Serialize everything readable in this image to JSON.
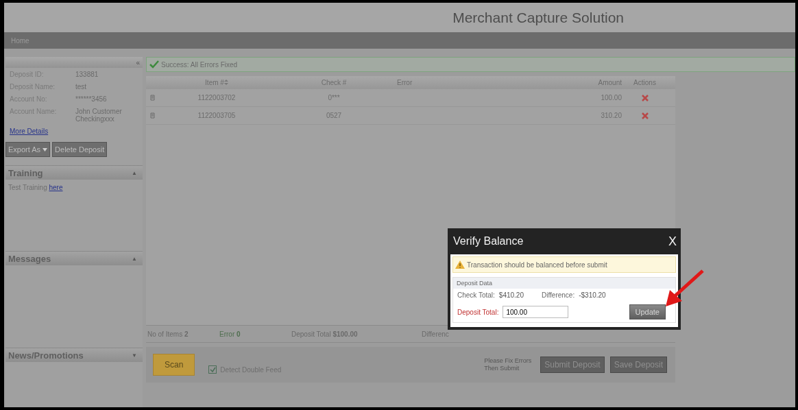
{
  "header": {
    "title": "Merchant Capture Solution"
  },
  "nav": [
    {
      "label": "Home"
    }
  ],
  "sidebar": {
    "collapse": "«",
    "details": [
      {
        "label": "Deposit ID:",
        "value": "133881"
      },
      {
        "label": "Deposit Name:",
        "value": "test"
      },
      {
        "label": "Account No:",
        "value": "******3456"
      },
      {
        "label": "Account Name:",
        "value": "John Customer Checkingxxx"
      }
    ],
    "more_details": "More Details",
    "buttons": [
      {
        "label": "Export As",
        "kind": "dropdown"
      },
      {
        "label": "Delete Deposit",
        "kind": "plain"
      }
    ],
    "panels": [
      {
        "title": "Training",
        "toggle": "▲",
        "text": "Test Training ",
        "link": "here"
      },
      {
        "title": "Messages",
        "toggle": "▲"
      },
      {
        "title": "News/Promotions",
        "toggle": "▼"
      }
    ]
  },
  "status": {
    "text": "Success: All Errors Fixed"
  },
  "table": {
    "columns": [
      {
        "label": "Item #",
        "sortable": true
      },
      {
        "label": "Check #",
        "sortable": false
      },
      {
        "label": "Error",
        "sortable": false
      },
      {
        "label": "Amount",
        "sortable": false
      },
      {
        "label": "Actions",
        "sortable": false
      }
    ],
    "rows": [
      {
        "item": "1122003702",
        "check": "0***",
        "amount": "100.00"
      },
      {
        "item": "1122003705",
        "check": "0527",
        "amount": "310.20"
      }
    ]
  },
  "summary": [
    "No of Items **2**",
    "Error **0**",
    "Deposit Total **$100.00**",
    "Differenc"
  ],
  "footer": {
    "scan": "Scan",
    "double_feed": {
      "label": "Detect Double Feed",
      "checked": true
    },
    "note": "Please Fix Errors Then Submit",
    "buttons": [
      "Submit Deposit",
      "Save Deposit"
    ]
  },
  "dialog": {
    "title": "Verify Balance",
    "close": "X",
    "warning": "Transaction should be balanced before submit",
    "section": "Deposit Data",
    "check_total": {
      "label": "Check Total:",
      "value": "$410.20"
    },
    "difference": {
      "label": "Difference:",
      "value": "-$310.20"
    },
    "deposit_total": {
      "label": "Deposit Total:",
      "value": "100.00"
    },
    "button": "Update"
  }
}
